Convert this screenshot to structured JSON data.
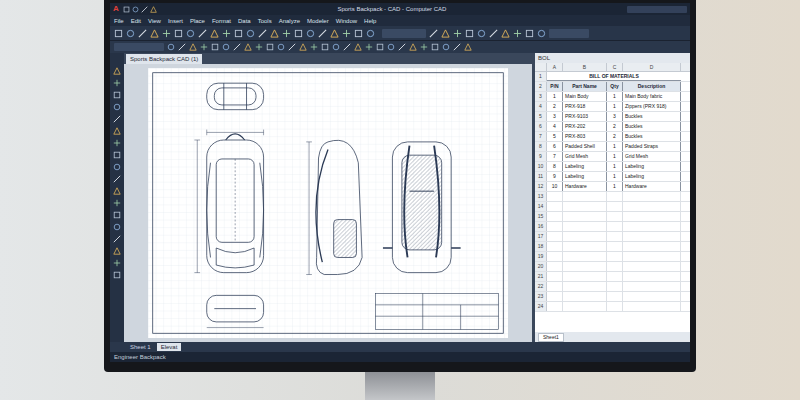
{
  "window": {
    "logo": "A",
    "title": "Sports Backpack - CAD - Computer CAD"
  },
  "menu": [
    "File",
    "Edit",
    "View",
    "Insert",
    "Place",
    "Format",
    "Data",
    "Tools",
    "Analyze",
    "Modeler",
    "Window",
    "Help"
  ],
  "drawing": {
    "tab": "Sports Backpack CAD (1)"
  },
  "sheet_tabs": [
    {
      "label": "Sheet 1",
      "selected": false
    },
    {
      "label": "Elevat",
      "selected": true
    }
  ],
  "status_bar": "Engineer Backpack",
  "spreadsheet": {
    "title": "BOL",
    "columns": [
      "A",
      "B",
      "C",
      "D"
    ],
    "row_numbers": [
      "1",
      "2",
      "3",
      "4",
      "5",
      "6",
      "7",
      "8",
      "9",
      "10",
      "11",
      "12",
      "13",
      "14",
      "15",
      "16",
      "17",
      "18",
      "19",
      "20",
      "21",
      "22",
      "23",
      "24"
    ],
    "sheet_tab": "Sheet1",
    "bom": {
      "title": "BILL OF MATERIALS",
      "headers": [
        "P/N",
        "Part Name",
        "Qty",
        "Description"
      ],
      "rows": [
        {
          "pn": "1",
          "part": "Main Body",
          "qty": "1",
          "desc": "Main Body fabric"
        },
        {
          "pn": "2",
          "part": "PRX-918",
          "qty": "1",
          "desc": "Zippers (PRX 918)"
        },
        {
          "pn": "3",
          "part": "PRX-9103",
          "qty": "3",
          "desc": "Buckles"
        },
        {
          "pn": "4",
          "part": "PRX-202",
          "qty": "2",
          "desc": "Buckles"
        },
        {
          "pn": "5",
          "part": "PRX-803",
          "qty": "2",
          "desc": "Buckles"
        },
        {
          "pn": "6",
          "part": "Padded Shell",
          "qty": "1",
          "desc": "Padded Straps"
        },
        {
          "pn": "7",
          "part": "Grid Mesh",
          "qty": "1",
          "desc": "Grid Mesh"
        },
        {
          "pn": "8",
          "part": "Labeling",
          "qty": "1",
          "desc": "Labeling"
        },
        {
          "pn": "9",
          "part": "Labeling",
          "qty": "1",
          "desc": "Labeling"
        },
        {
          "pn": "10",
          "part": "Hardware",
          "qty": "1",
          "desc": "Hardware"
        }
      ]
    }
  }
}
